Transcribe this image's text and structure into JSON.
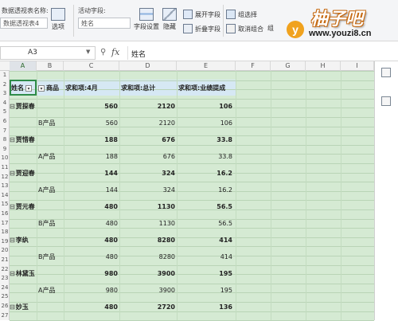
{
  "ribbon": {
    "pivot_name_label": "数据透视表名称:",
    "pivot_name_value": "数据透视表4",
    "options_label": "选项",
    "active_field_label": "活动字段:",
    "active_field_value": "姓名",
    "field_settings": "字段设置",
    "hide": "隐藏",
    "expand_field": "展开字段",
    "collapse_field": "折叠字段",
    "group_selection": "组选择",
    "ungroup": "取消组合",
    "group_field_short": "组"
  },
  "watermark": {
    "circle_letter": "y",
    "title": "柚子吧",
    "url": "www.youzi8.cn"
  },
  "formula_bar": {
    "cell_ref": "A3",
    "fx": "fx",
    "content": "姓名"
  },
  "columns": [
    "A",
    "B",
    "C",
    "D",
    "E",
    "F",
    "G",
    "H",
    "I"
  ],
  "rows": [
    "1",
    "2",
    "3",
    "4",
    "5",
    "6",
    "7",
    "8",
    "9",
    "10",
    "11",
    "12",
    "13",
    "14",
    "15",
    "16",
    "17",
    "18",
    "19",
    "20",
    "21",
    "22",
    "23",
    "24",
    "25",
    "26",
    "27"
  ],
  "pivot": {
    "headers": [
      "姓名",
      "商品",
      "求和项:4月",
      "求和项:总计",
      "求和项:业绩提成"
    ],
    "rows": [
      {
        "name": "贾探春",
        "product": "",
        "apr": "560",
        "total": "2120",
        "bonus": "106",
        "is_group": true
      },
      {
        "name": "",
        "product": "B产品",
        "apr": "560",
        "total": "2120",
        "bonus": "106",
        "is_group": false
      },
      {
        "name": "贾惜春",
        "product": "",
        "apr": "188",
        "total": "676",
        "bonus": "33.8",
        "is_group": true
      },
      {
        "name": "",
        "product": "A产品",
        "apr": "188",
        "total": "676",
        "bonus": "33.8",
        "is_group": false
      },
      {
        "name": "贾迎春",
        "product": "",
        "apr": "144",
        "total": "324",
        "bonus": "16.2",
        "is_group": true
      },
      {
        "name": "",
        "product": "A产品",
        "apr": "144",
        "total": "324",
        "bonus": "16.2",
        "is_group": false
      },
      {
        "name": "贾元春",
        "product": "",
        "apr": "480",
        "total": "1130",
        "bonus": "56.5",
        "is_group": true
      },
      {
        "name": "",
        "product": "B产品",
        "apr": "480",
        "total": "1130",
        "bonus": "56.5",
        "is_group": false
      },
      {
        "name": "李纨",
        "product": "",
        "apr": "480",
        "total": "8280",
        "bonus": "414",
        "is_group": true
      },
      {
        "name": "",
        "product": "B产品",
        "apr": "480",
        "total": "8280",
        "bonus": "414",
        "is_group": false
      },
      {
        "name": "林黛玉",
        "product": "",
        "apr": "980",
        "total": "3900",
        "bonus": "195",
        "is_group": true
      },
      {
        "name": "",
        "product": "A产品",
        "apr": "980",
        "total": "3900",
        "bonus": "195",
        "is_group": false
      },
      {
        "name": "妙玉",
        "product": "",
        "apr": "480",
        "total": "2720",
        "bonus": "136",
        "is_group": true
      }
    ]
  }
}
